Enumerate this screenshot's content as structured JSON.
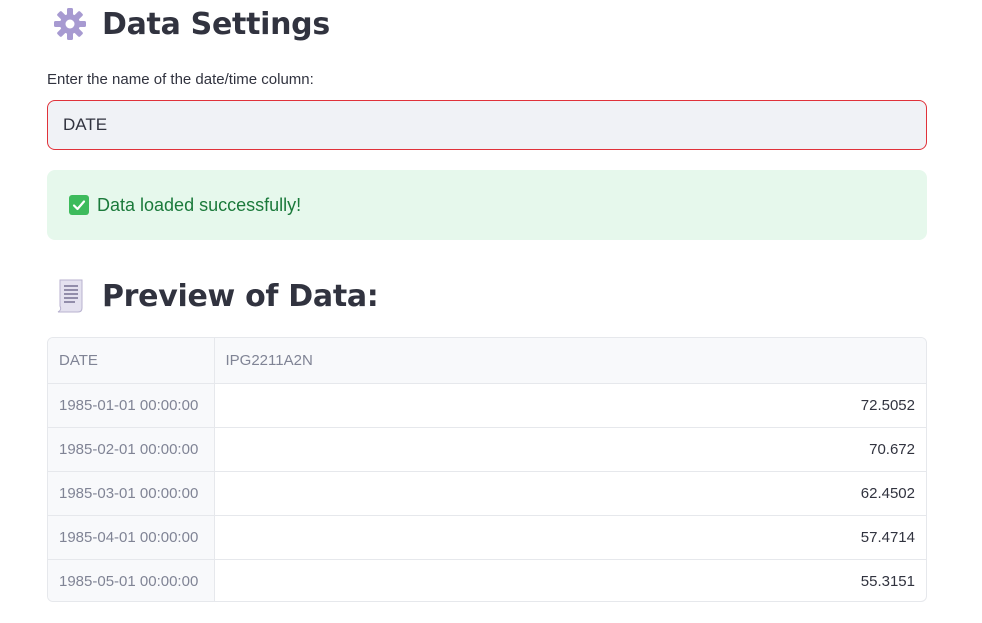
{
  "settings": {
    "title": "Data Settings",
    "icon": "gear-icon",
    "date_column_label": "Enter the name of the date/time column:",
    "date_column_value": "DATE"
  },
  "alert": {
    "icon": "check-icon",
    "message": "Data loaded successfully!",
    "color": "#1b7a3b"
  },
  "preview": {
    "title": "Preview of Data:",
    "icon": "receipt-icon",
    "columns": [
      "DATE",
      "IPG2211A2N"
    ],
    "rows": [
      [
        "1985-01-01 00:00:00",
        "72.5052"
      ],
      [
        "1985-02-01 00:00:00",
        "70.672"
      ],
      [
        "1985-03-01 00:00:00",
        "62.4502"
      ],
      [
        "1985-04-01 00:00:00",
        "57.4714"
      ],
      [
        "1985-05-01 00:00:00",
        "55.3151"
      ]
    ]
  }
}
